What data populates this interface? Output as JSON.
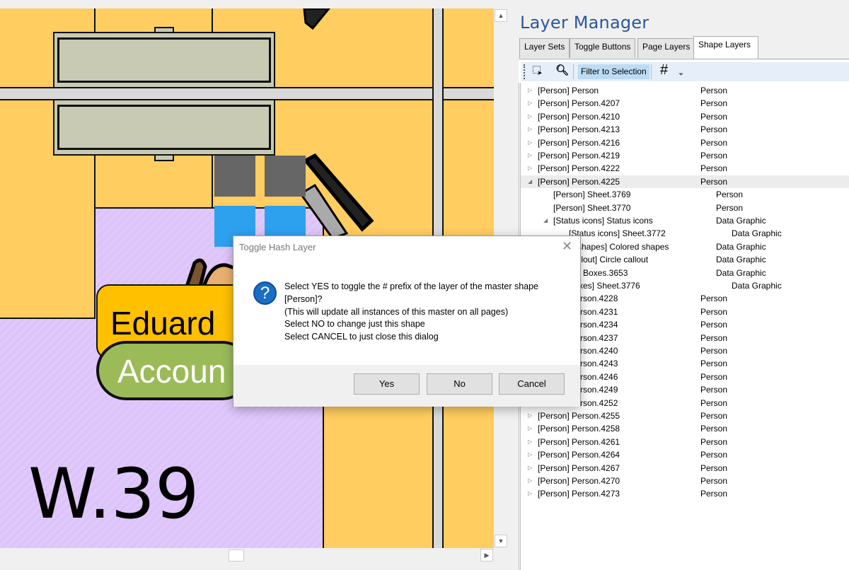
{
  "canvas": {
    "badge_name": "Eduard",
    "badge_dept": "Accoun",
    "room_label": "W.39",
    "colors": {
      "floor": "#ffcd60",
      "room": "#e0c8fc",
      "desk": "#c9cab3",
      "status_gray": "#666666",
      "status_blue": "#2ea1ee",
      "name_badge": "#ffc000",
      "dept_badge": "#9bbb59"
    }
  },
  "panel": {
    "title": "Layer Manager",
    "tabs": [
      {
        "label": "Layer Sets",
        "active": false
      },
      {
        "label": "Toggle Buttons",
        "active": false
      },
      {
        "label": "Page Layers",
        "active": false
      },
      {
        "label": "Shape Layers",
        "active": true
      }
    ],
    "toolbar": {
      "select_icon": "select-region-icon",
      "zoom_icon": "zoom-icon",
      "filter_label": "Filter to Selection",
      "hash_label": "#",
      "overflow_icon": "overflow-chevron-icon"
    },
    "tree": [
      {
        "name": "[Person] Person",
        "type": "Person",
        "depth": 0,
        "expander": "collapsed"
      },
      {
        "name": "[Person] Person.4207",
        "type": "Person",
        "depth": 0,
        "expander": "collapsed"
      },
      {
        "name": "[Person] Person.4210",
        "type": "Person",
        "depth": 0,
        "expander": "collapsed"
      },
      {
        "name": "[Person] Person.4213",
        "type": "Person",
        "depth": 0,
        "expander": "collapsed"
      },
      {
        "name": "[Person] Person.4216",
        "type": "Person",
        "depth": 0,
        "expander": "collapsed"
      },
      {
        "name": "[Person] Person.4219",
        "type": "Person",
        "depth": 0,
        "expander": "collapsed"
      },
      {
        "name": "[Person] Person.4222",
        "type": "Person",
        "depth": 0,
        "expander": "collapsed"
      },
      {
        "name": "[Person] Person.4225",
        "type": "Person",
        "depth": 0,
        "expander": "expanded",
        "selected": true
      },
      {
        "name": "[Person] Sheet.3769",
        "type": "Person",
        "depth": 1,
        "expander": "none"
      },
      {
        "name": "[Person] Sheet.3770",
        "type": "Person",
        "depth": 1,
        "expander": "none"
      },
      {
        "name": "[Status icons] Status icons",
        "type": "Data Graphic",
        "depth": 1,
        "expander": "expanded"
      },
      {
        "name": "[Status icons] Sheet.3772",
        "type": "Data Graphic",
        "depth": 2,
        "expander": "none"
      },
      {
        "name": "d shapes] Colored shapes",
        "type": "Data Graphic",
        "depth": 1,
        "expander": "none"
      },
      {
        "name": "callout] Circle callout",
        "type": "Data Graphic",
        "depth": 1,
        "expander": "none"
      },
      {
        "name": "Boxes.3653",
        "type": "Data Graphic",
        "depth": 1,
        "expander": "none"
      },
      {
        "name": "xes] Sheet.3776",
        "type": "Data Graphic",
        "depth": 2,
        "expander": "none"
      },
      {
        "name": "rson.4228",
        "type": "Person",
        "depth": 0,
        "expander": "collapsed"
      },
      {
        "name": "rson.4231",
        "type": "Person",
        "depth": 0,
        "expander": "collapsed"
      },
      {
        "name": "rson.4234",
        "type": "Person",
        "depth": 0,
        "expander": "collapsed"
      },
      {
        "name": "rson.4237",
        "type": "Person",
        "depth": 0,
        "expander": "collapsed"
      },
      {
        "name": "rson.4240",
        "type": "Person",
        "depth": 0,
        "expander": "collapsed"
      },
      {
        "name": "rson.4243",
        "type": "Person",
        "depth": 0,
        "expander": "collapsed"
      },
      {
        "name": "rson.4246",
        "type": "Person",
        "depth": 0,
        "expander": "collapsed"
      },
      {
        "name": "rson.4249",
        "type": "Person",
        "depth": 0,
        "expander": "collapsed"
      },
      {
        "name": "rson.4252",
        "type": "Person",
        "depth": 0,
        "expander": "collapsed"
      },
      {
        "name": "[Person] Person.4255",
        "type": "Person",
        "depth": 0,
        "expander": "collapsed"
      },
      {
        "name": "[Person] Person.4258",
        "type": "Person",
        "depth": 0,
        "expander": "collapsed"
      },
      {
        "name": "[Person] Person.4261",
        "type": "Person",
        "depth": 0,
        "expander": "collapsed"
      },
      {
        "name": "[Person] Person.4264",
        "type": "Person",
        "depth": 0,
        "expander": "collapsed"
      },
      {
        "name": "[Person] Person.4267",
        "type": "Person",
        "depth": 0,
        "expander": "collapsed"
      },
      {
        "name": "[Person] Person.4270",
        "type": "Person",
        "depth": 0,
        "expander": "collapsed"
      },
      {
        "name": "[Person] Person.4273",
        "type": "Person",
        "depth": 0,
        "expander": "collapsed"
      }
    ]
  },
  "dialog": {
    "title": "Toggle Hash Layer",
    "icon": "question-icon",
    "lines": [
      "Select YES to toggle the # prefix of the layer of the master shape",
      "[Person]?",
      "(This will update all instances of this master on all pages)",
      "Select NO to change just this shape",
      "Select CANCEL to just close this dialog"
    ],
    "buttons": {
      "yes": "Yes",
      "no": "No",
      "cancel": "Cancel"
    }
  }
}
